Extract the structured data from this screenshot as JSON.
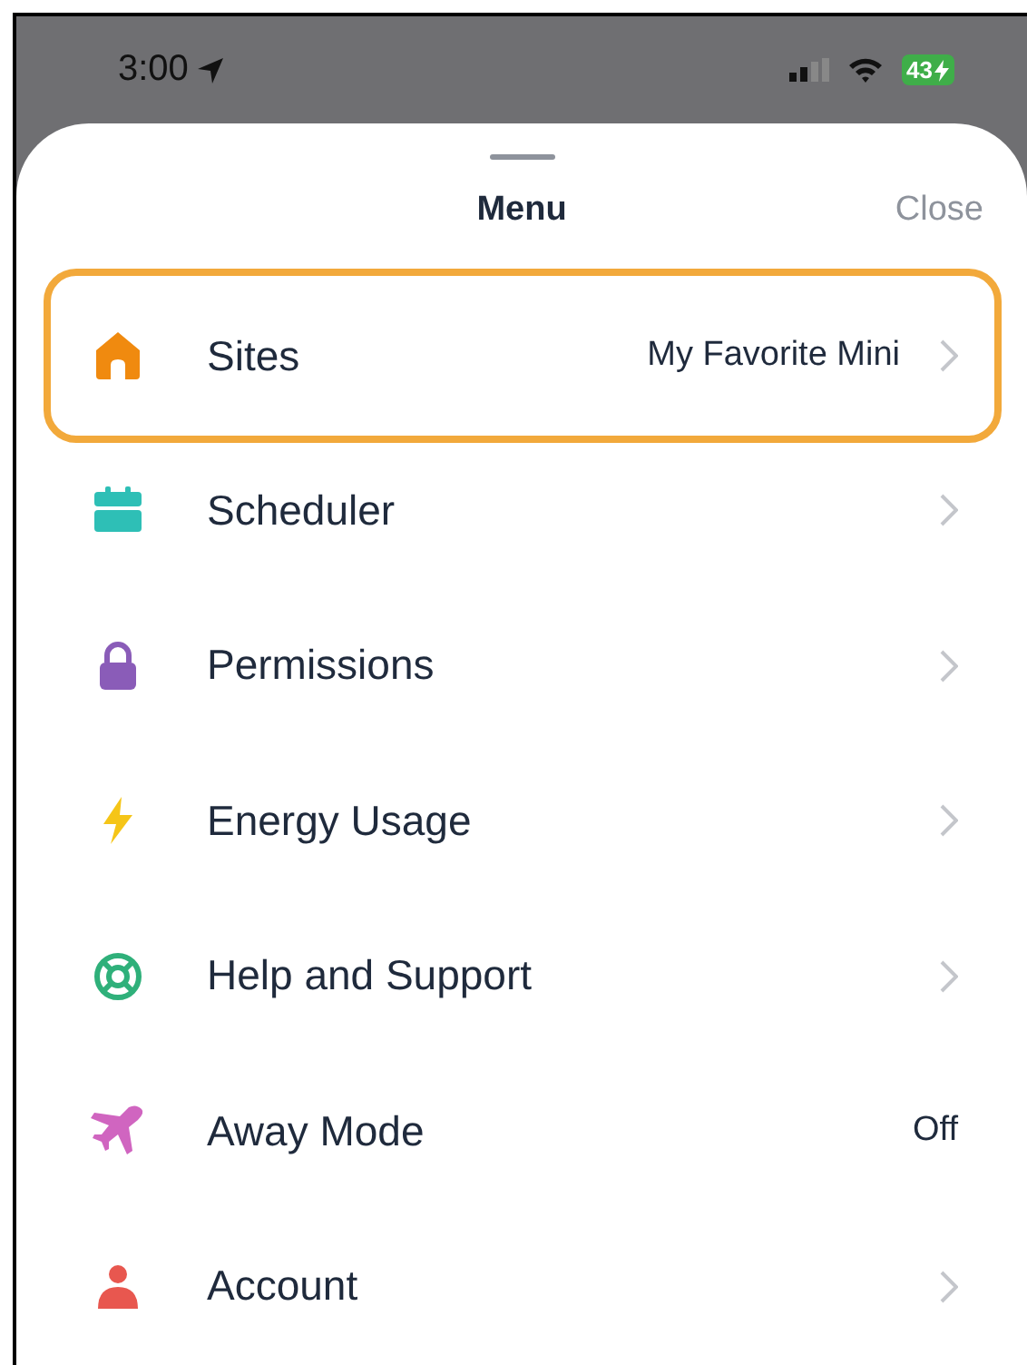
{
  "status_bar": {
    "time": "3:00",
    "battery": "43"
  },
  "header": {
    "title": "Menu",
    "close": "Close"
  },
  "items": [
    {
      "label": "Sites",
      "value": "My Favorite Mini",
      "chevron": true,
      "selected": true,
      "color": "#f08a0f"
    },
    {
      "label": "Scheduler",
      "chevron": true,
      "selected": false,
      "color": "#2ebfb6"
    },
    {
      "label": "Permissions",
      "chevron": true,
      "selected": false,
      "color": "#8a5cb8"
    },
    {
      "label": "Energy Usage",
      "chevron": true,
      "selected": false,
      "color": "#f5c518"
    },
    {
      "label": "Help and Support",
      "chevron": true,
      "selected": false,
      "color": "#2fb07a"
    },
    {
      "label": "Away Mode",
      "value": "Off",
      "chevron": false,
      "selected": false,
      "color": "#d065c0"
    },
    {
      "label": "Account",
      "chevron": true,
      "selected": false,
      "color": "#e8574f"
    }
  ]
}
